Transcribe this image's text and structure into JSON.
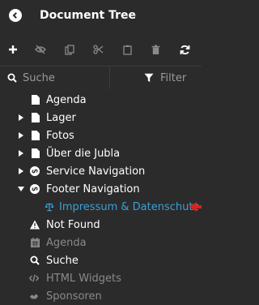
{
  "header": {
    "title": "Document Tree"
  },
  "toolbar": {
    "items": [
      "add-icon",
      "hide-icon",
      "copy-icon",
      "cut-icon",
      "paste-icon",
      "delete-icon",
      "refresh-icon"
    ]
  },
  "search": {
    "placeholder": "Suche",
    "filter_label": "Filter"
  },
  "tree": {
    "items": [
      {
        "label": "Agenda",
        "icon": "document-icon"
      },
      {
        "label": "Lager",
        "icon": "document-icon"
      },
      {
        "label": "Fotos",
        "icon": "document-icon"
      },
      {
        "label": "Über die Jubla",
        "icon": "document-icon"
      },
      {
        "label": "Service Navigation",
        "icon": "link-icon"
      },
      {
        "label": "Footer Navigation",
        "icon": "link-icon"
      },
      {
        "label": "Impressum & Datenschutz",
        "icon": "scale-icon"
      },
      {
        "label": "Not Found",
        "icon": "warning-icon"
      },
      {
        "label": "Agenda",
        "icon": "calendar-icon"
      },
      {
        "label": "Suche",
        "icon": "search-icon"
      },
      {
        "label": "HTML Widgets",
        "icon": "code-icon"
      },
      {
        "label": "Sponsoren",
        "icon": "sponsor-icon"
      }
    ]
  },
  "colors": {
    "background": "#2b2b2b",
    "active": "#3aa0d8",
    "marker": "#e0201b",
    "dim": "#8a8a8a"
  }
}
